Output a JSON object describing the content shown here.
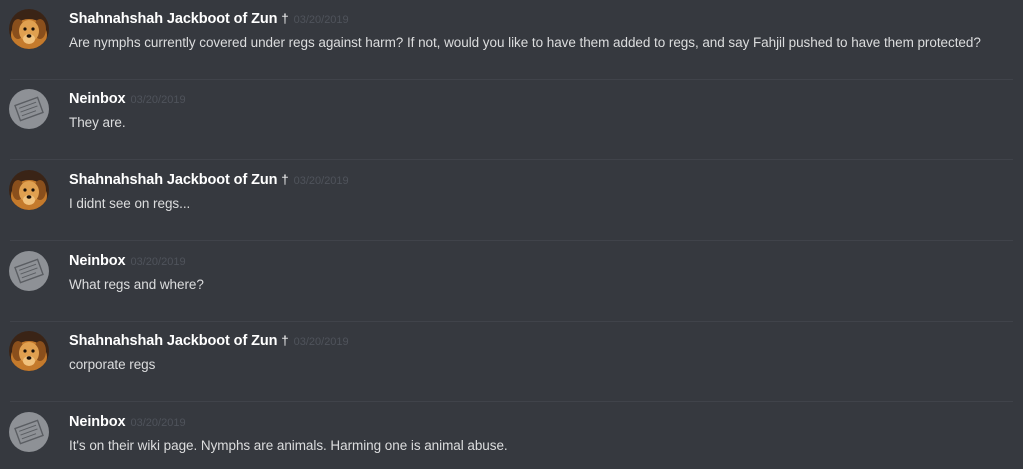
{
  "messages": [
    {
      "username": "Shahnahshah Jackboot of Zun",
      "user_mark": "†",
      "timestamp": "03/20/2019",
      "text": "Are nymphs currently covered under regs against harm? If not, would you like to have them added to regs, and say Fahjil pushed to have them protected?",
      "avatar": "dog-avatar"
    },
    {
      "username": "Neinbox",
      "user_mark": "",
      "timestamp": "03/20/2019",
      "text": "They are.",
      "avatar": "neinbox-avatar"
    },
    {
      "username": "Shahnahshah Jackboot of Zun",
      "user_mark": "†",
      "timestamp": "03/20/2019",
      "text": "I didnt see on regs...",
      "avatar": "dog-avatar"
    },
    {
      "username": "Neinbox",
      "user_mark": "",
      "timestamp": "03/20/2019",
      "text": "What regs and where?",
      "avatar": "neinbox-avatar"
    },
    {
      "username": "Shahnahshah Jackboot of Zun",
      "user_mark": "†",
      "timestamp": "03/20/2019",
      "text": "corporate regs",
      "avatar": "dog-avatar"
    },
    {
      "username": "Neinbox",
      "user_mark": "",
      "timestamp": "03/20/2019",
      "text": "It's on their wiki page. Nymphs are animals. Harming one is animal abuse.",
      "avatar": "neinbox-avatar"
    }
  ],
  "colors": {
    "background": "#36393f",
    "username": "#ffffff",
    "timestamp": "#4f535b",
    "message_text": "#dcddde",
    "divider": "#40434a"
  }
}
